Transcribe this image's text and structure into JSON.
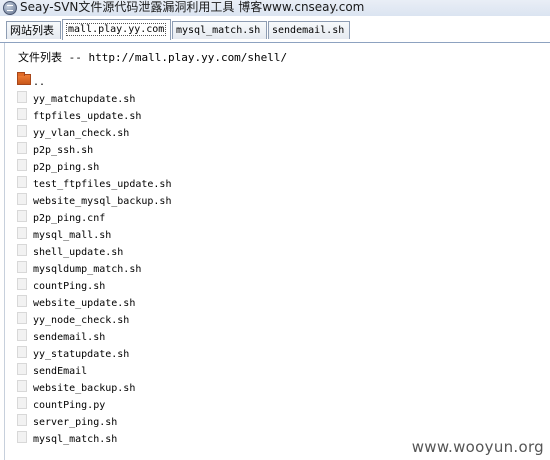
{
  "window": {
    "title": "Seay-SVN文件源代码泄露漏洞利用工具 博客www.cnseay.com"
  },
  "tabs": [
    {
      "label": "网站列表",
      "active": false,
      "mono": false
    },
    {
      "label": "mall.play.yy.com",
      "active": true,
      "mono": true
    },
    {
      "label": "mysql_match.sh",
      "active": false,
      "mono": true
    },
    {
      "label": "sendemail.sh",
      "active": false,
      "mono": true
    }
  ],
  "content": {
    "path_label": "文件列表 -- http://mall.play.yy.com/shell/",
    "parent_dir": "..",
    "files": [
      "yy_matchupdate.sh",
      "ftpfiles_update.sh",
      "yy_vlan_check.sh",
      "p2p_ssh.sh",
      "p2p_ping.sh",
      "test_ftpfiles_update.sh",
      "website_mysql_backup.sh",
      "p2p_ping.cnf",
      "mysql_mall.sh",
      "shell_update.sh",
      "mysqldump_match.sh",
      "countPing.sh",
      "website_update.sh",
      "yy_node_check.sh",
      "sendemail.sh",
      "yy_statupdate.sh",
      "sendEmail",
      "website_backup.sh",
      "countPing.py",
      "server_ping.sh",
      "mysql_match.sh"
    ]
  },
  "watermark": "www.wooyun.org",
  "icons": {
    "app": "app-icon",
    "folder": "folder-up-icon",
    "file": "file-icon"
  },
  "colors": {
    "folder_orange": "#e06a26",
    "tab_border": "#8e9db3"
  }
}
